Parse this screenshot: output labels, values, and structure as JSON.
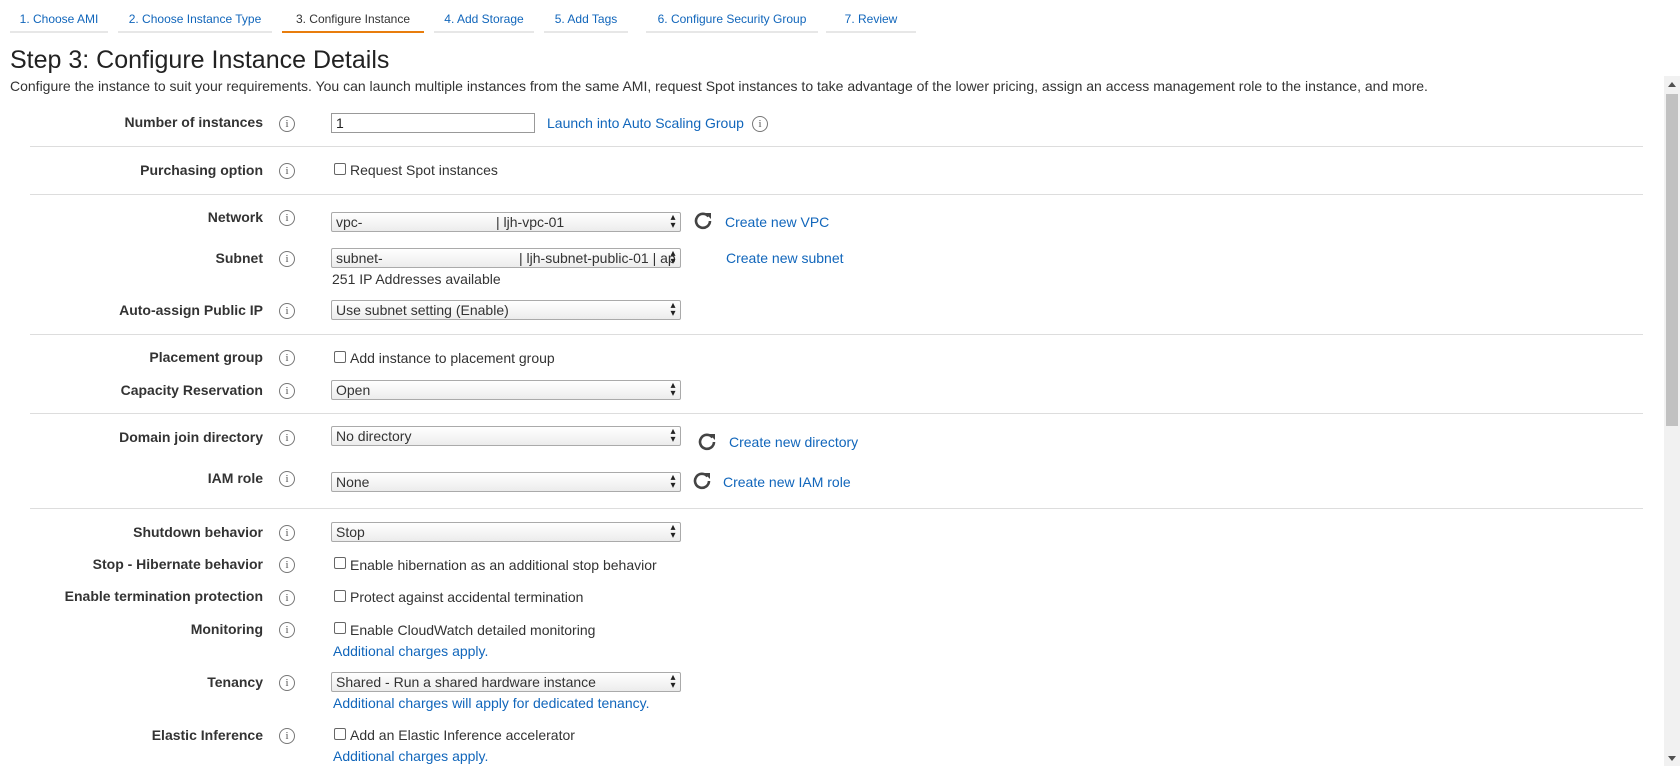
{
  "tabs": [
    {
      "label": "1. Choose AMI"
    },
    {
      "label": "2. Choose Instance Type"
    },
    {
      "label": "3. Configure Instance"
    },
    {
      "label": "4. Add Storage"
    },
    {
      "label": "5. Add Tags"
    },
    {
      "label": "6. Configure Security Group"
    },
    {
      "label": "7. Review"
    }
  ],
  "active_tab": "3. Configure Instance",
  "page": {
    "title": "Step 3: Configure Instance Details",
    "description": "Configure the instance to suit your requirements. You can launch multiple instances from the same AMI, request Spot instances to take advantage of the lower pricing, assign an access management role to the instance, and more."
  },
  "info_glyph": "i",
  "fields": {
    "number_of_instances": {
      "label": "Number of instances",
      "value": "1",
      "link": "Launch into Auto Scaling Group"
    },
    "purchasing_option": {
      "label": "Purchasing option",
      "checkbox_label": "Request Spot instances",
      "checked": false
    },
    "network": {
      "label": "Network",
      "prefix": "vpc-",
      "name": "| ljh-vpc-01",
      "link": "Create new VPC"
    },
    "subnet": {
      "label": "Subnet",
      "prefix": "subnet-",
      "name": "| ljh-subnet-public-01 | ap",
      "note": "251 IP Addresses available",
      "link": "Create new subnet"
    },
    "auto_assign_ip": {
      "label": "Auto-assign Public IP",
      "value": "Use subnet setting (Enable)"
    },
    "placement_group": {
      "label": "Placement group",
      "checkbox_label": "Add instance to placement group",
      "checked": false
    },
    "capacity_reservation": {
      "label": "Capacity Reservation",
      "value": "Open"
    },
    "domain_join": {
      "label": "Domain join directory",
      "value": "No directory",
      "link": "Create new directory"
    },
    "iam_role": {
      "label": "IAM role",
      "value": "None",
      "link": "Create new IAM role"
    },
    "shutdown_behavior": {
      "label": "Shutdown behavior",
      "value": "Stop"
    },
    "hibernate": {
      "label": "Stop - Hibernate behavior",
      "checkbox_label": "Enable hibernation as an additional stop behavior",
      "checked": false
    },
    "termination_protection": {
      "label": "Enable termination protection",
      "checkbox_label": "Protect against accidental termination",
      "checked": false
    },
    "monitoring": {
      "label": "Monitoring",
      "checkbox_label": "Enable CloudWatch detailed monitoring",
      "checked": false,
      "link": "Additional charges apply."
    },
    "tenancy": {
      "label": "Tenancy",
      "value": "Shared - Run a shared hardware instance",
      "link": "Additional charges will apply for dedicated tenancy."
    },
    "elastic_inference": {
      "label": "Elastic Inference",
      "checkbox_label": "Add an Elastic Inference accelerator",
      "checked": false,
      "link": "Additional charges apply."
    }
  },
  "colors": {
    "link": "#1166bb",
    "active_tab_border": "#e87d0d",
    "divider": "#dddddd"
  }
}
